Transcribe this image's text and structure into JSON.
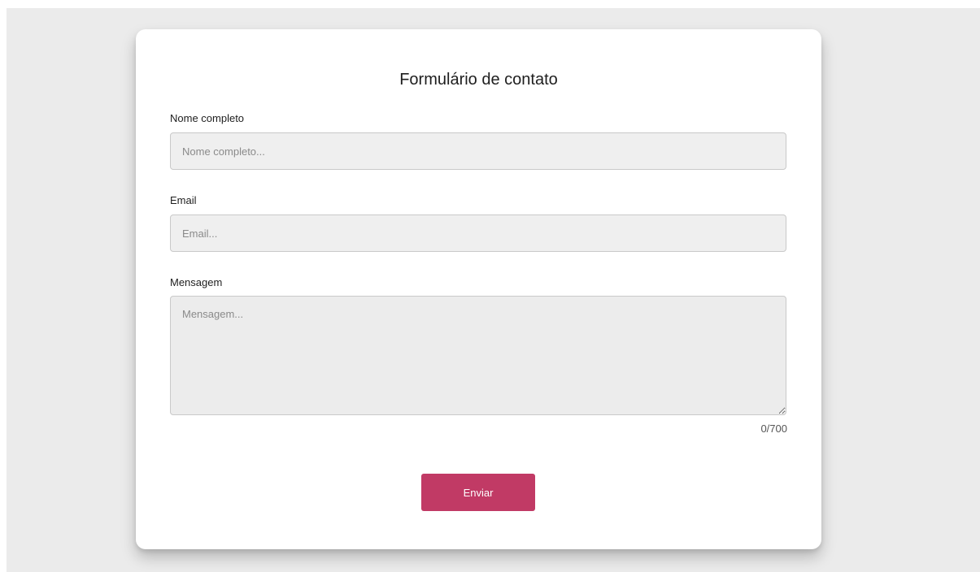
{
  "form": {
    "title": "Formulário de contato",
    "name_label": "Nome completo",
    "name_placeholder": "Nome completo...",
    "email_label": "Email",
    "email_placeholder": "Email...",
    "message_label": "Mensagem",
    "message_placeholder": "Mensagem...",
    "char_count": "0/700",
    "submit_label": "Enviar"
  },
  "colors": {
    "page_background": "#ebebeb",
    "card_background": "#ffffff",
    "input_background": "#efefef",
    "submit_button": "#c13a65"
  }
}
